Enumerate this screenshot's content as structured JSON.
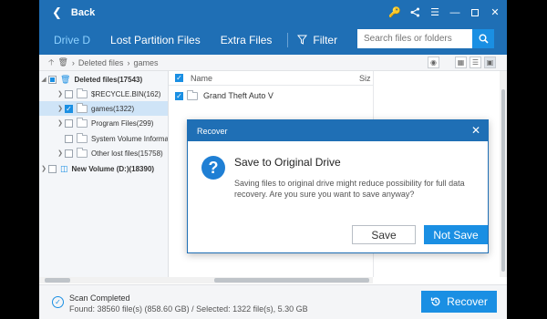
{
  "titlebar": {
    "back_label": "Back"
  },
  "nav": {
    "tabs": [
      {
        "label": "Drive D",
        "active": true
      },
      {
        "label": "Lost Partition Files",
        "active": false
      },
      {
        "label": "Extra Files",
        "active": false
      }
    ],
    "filter_label": "Filter",
    "search_placeholder": "Search files or folders"
  },
  "pathbar": {
    "crumbs": [
      "Deleted files",
      "games"
    ]
  },
  "tree": [
    {
      "label": "Deleted files(17543)",
      "bold": true
    },
    {
      "label": "$RECYCLE.BIN(162)"
    },
    {
      "label": "games(1322)"
    },
    {
      "label": "Program Files(299)"
    },
    {
      "label": "System Volume Informa"
    },
    {
      "label": "Other lost files(15758)"
    },
    {
      "label": "New Volume (D:)(18390)",
      "bold": true
    }
  ],
  "filelist": {
    "col_name": "Name",
    "col_size": "Siz",
    "rows": [
      {
        "name": "Grand Theft Auto V"
      }
    ]
  },
  "status": {
    "title": "Scan Completed",
    "detail": "Found: 38560 file(s) (858.60 GB) / Selected: 1322 file(s), 5.30 GB"
  },
  "recover_button": "Recover",
  "dialog": {
    "header": "Recover",
    "title": "Save to Original Drive",
    "message": "Saving files to original drive might reduce possibility for full data recovery. Are you sure you want to save anyway?",
    "save_label": "Save",
    "not_save_label": "Not Save"
  },
  "colors": {
    "primary": "#1f6fb5",
    "accent": "#1a8fe3",
    "active_tab": "#8dd1ff"
  },
  "icons": [
    "back-chevron-icon",
    "key-icon",
    "share-icon",
    "menu-icon",
    "minimize-icon",
    "maximize-icon",
    "close-icon",
    "filter-icon",
    "search-icon",
    "question-icon",
    "scan-complete-icon",
    "recover-icon"
  ]
}
